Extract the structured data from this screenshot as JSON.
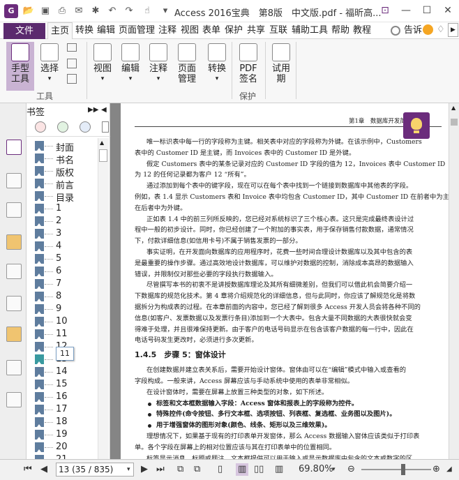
{
  "window": {
    "title": "Access 2016宝典　第8版　中文版.pdf - 福昕高...",
    "app_logo": "G"
  },
  "quick_access": [
    "open-icon",
    "save-icon",
    "print-icon",
    "email-icon",
    "new-icon",
    "undo-icon",
    "redo-icon",
    "hand-icon",
    "customize-icon"
  ],
  "menu": {
    "file": "文件",
    "items": [
      "主页",
      "转换",
      "编辑",
      "页面管理",
      "注释",
      "视图",
      "表单",
      "保护",
      "共享",
      "互联",
      "辅助工具",
      "帮助",
      "教程"
    ],
    "tell_me": "告诉"
  },
  "ribbon": {
    "hand_tool": "手型\n工具",
    "select": "选择",
    "group_tools": "工具",
    "view": "视图",
    "edit": "编辑",
    "comment": "注释",
    "page_manage": "页面\n管理",
    "convert": "转换",
    "pdf_sign": "PDF\n签名",
    "group_protect": "保护",
    "trial": "试用\n期"
  },
  "bookmarks": {
    "title": "书签",
    "items": [
      "封面",
      "书名",
      "版权",
      "前言",
      "目录",
      "1",
      "2",
      "3",
      "4",
      "5",
      "6",
      "7",
      "8",
      "9",
      "10",
      "11",
      "12",
      "13",
      "14",
      "15",
      "16",
      "17",
      "18",
      "19",
      "20",
      "21"
    ],
    "tooltip": "11"
  },
  "document": {
    "header": "第1章　数据库开发简介",
    "lines": [
      "唯一标识表中每一行的字段称为主键。相关表中对应的字段称为外键。在该示例中，Customers",
      "表中的 Customer ID 是主键，而 Invoices 表中的 Customer ID 是外键。",
      "假定 Customers 表中的某条记录对应的 Customer ID 字段的值为 12，Invoices 表中 Customer ID",
      "为 12 的任何记录都为客户 12 “所有”。",
      "通过添加到每个表中的键字段，现在可以在每个表中找到一个链接到数据库中其他表的字段。",
      "例如，表 1.4 显示 Customers 表和 Invoice 表中均包含 Customer ID，其中 Customer ID 在前者中为主键，",
      "在后者中为外键。",
      "正如表 1.4 中的前三列所反映的，您已经对系统标识了三个核心表。这只是完成最终表设计过",
      "程中一般的初步设计。同时，你已经创建了一个附加的事实表，用于保存销售付款数据，通常情况",
      "下，付款详细信息(如信用卡号)不属于销售发票的一部分。",
      "事实证明，在开发面向数据库的应用程序时，花费一些时间合理设计数据库以及其中包含的表",
      "是最重要的操作步骤。通过高效地设计数据库，可以维护对数据的控制，消除成本高昂的数据输入",
      "错误，并限制仅对那些必要的字段执行数据输入。",
      "尽管撰写本书的初衷不是讲授数据库理论及其所有细微差别，但我们可以借此机会简要介绍一",
      "下数据库的规范化技术。第 4 章将介绍规范化的详细信息，但与此同时，你应该了解规范化是将数",
      "据拆分为构成表的过程。在本章前面的内容中，您已经了解到很多 Access 开发人员会将各种不同的",
      "信息(如客户、发票数据以及发票行条目)添加到一个大表中。包含大量不同数据的大表很快就会变",
      "得难于处理，并且很难保持更新。由于客户的电话号码显示在包含该客户数据的每一行中，因此在",
      "电话号码发生更改时，必须进行多次更新。",
      "1.4.5　步骤 5：窗体设计",
      "在创建数据并建立表关系后，需要开始设计窗体。窗体由可以在“编辑”模式中输入或查看的",
      "字段构成。一般来讲，Access 屏幕应该与手动系统中使用的表单非常相似。",
      "在设计窗体时，需要在屏幕上放置三种类型的对象，如下所述。",
      "标签和文本框数据输入字段：Access 窗体和报表上的字段称为控件。",
      "特殊控件(命令按钮、多行文本框、选项按钮、列表框、复选框、业务图以及图片)。",
      "用于增强窗体的图形对象(颜色、线条、矩形以及三维效果)。",
      "理想情况下，如果基于现有的打印表单开发窗体，那么 Access 数据输入窗体应该类似于打印表",
      "单。各个字段在屏幕上的相对位置应该与其在打印表单中的位置相同。",
      "标签显示消息、标题或题注。文本框提供可以用于输入或显示数据库中包含的文本或数字的区",
      "域。复选框表示一种情况，要么处于未选中状态，要么处于选中状态。Access 中可以使用的其他类"
    ]
  },
  "status": {
    "page_box": "13 (35 / 835)",
    "zoom": "69.80%"
  },
  "colors": {
    "brand": "#6b2c7c",
    "bookmark_flag": "#5f7d9e"
  }
}
